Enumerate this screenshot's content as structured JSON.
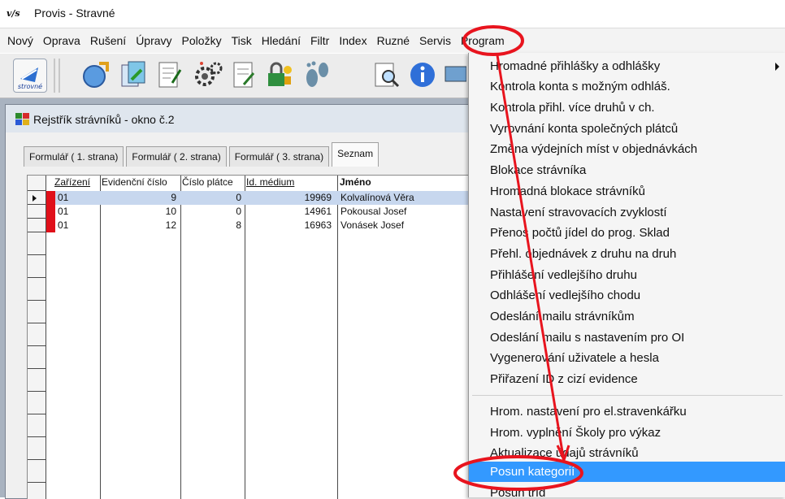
{
  "window": {
    "logo": "v/s",
    "title": "Provis - Stravné"
  },
  "menubar": {
    "items": [
      {
        "label": "Nový",
        "key": "Nový"
      },
      {
        "label": "Oprava"
      },
      {
        "label": "Rušení"
      },
      {
        "label": "Úpravy"
      },
      {
        "label": "Položky"
      },
      {
        "label": "Tisk"
      },
      {
        "label": "Hledání"
      },
      {
        "label": "Filtr"
      },
      {
        "label": "Index"
      },
      {
        "label": "Ruzné"
      },
      {
        "label": "Servis"
      },
      {
        "label": "Program"
      }
    ]
  },
  "toolbar": {
    "stravne_label": "strovné",
    "icons": [
      "stravne-icon",
      "refresh-globe-icon",
      "copy-pages-icon",
      "edit-list-icon",
      "gears-icon",
      "document-edit-icon",
      "lock-key-icon",
      "footprints-icon",
      "search-document-icon",
      "info-icon"
    ]
  },
  "child_window": {
    "title": "Rejstřík strávníků - okno č.2"
  },
  "tabs": [
    {
      "label": "Formulář ( 1. strana)"
    },
    {
      "label": "Formulář ( 2. strana)"
    },
    {
      "label": "Formulář ( 3. strana)"
    },
    {
      "label": "Seznam"
    }
  ],
  "grid": {
    "headers": [
      "Zařízení",
      "Evidenční číslo",
      "Číslo plátce",
      "Id. médium",
      "Jméno"
    ],
    "rows": [
      {
        "zarizeni": "01",
        "evid": "9",
        "platce": "0",
        "medium": "19969",
        "jmeno": "Kolvalínová Věra"
      },
      {
        "zarizeni": "01",
        "evid": "10",
        "platce": "0",
        "medium": "14961",
        "jmeno": "Pokousal Josef"
      },
      {
        "zarizeni": "01",
        "evid": "12",
        "platce": "8",
        "medium": "16963",
        "jmeno": "Vonásek Josef"
      }
    ]
  },
  "dropdown": {
    "items": [
      {
        "label": "Hromadné přihlášky a odhlášky"
      },
      {
        "label": "Kontrola konta s možným odhláš."
      },
      {
        "label": "Kontrola přihl. více druhů v ch."
      },
      {
        "label": "Vyrovnání konta společných plátců"
      },
      {
        "label": "Změna výdejních míst v objednávkách"
      },
      {
        "label": "Blokace strávníka"
      },
      {
        "label": "Hromadná blokace strávníků"
      },
      {
        "label": "Nastavení stravovacích zvyklostí"
      },
      {
        "label": "Přenos počtů jídel do prog. Sklad"
      },
      {
        "label": "Přehl. objednávek z druhu na druh"
      },
      {
        "label": "Přihlášení vedlejšího druhu"
      },
      {
        "label": "Odhlášení vedlejšího chodu"
      },
      {
        "label": "Odeslání mailu strávníkům"
      },
      {
        "label": "Odeslání mailu s nastavením pro OI"
      },
      {
        "label": "Vygenerování uživatele a hesla"
      },
      {
        "label": "Přiřazení ID z cizí evidence"
      },
      {
        "label": "Hrom. nastavení pro el.stravenkářku"
      },
      {
        "label": "Hrom. vyplnění Školy pro výkaz"
      },
      {
        "label": "Aktualizace údajů strávníků"
      },
      {
        "label": "Posun kategorií"
      },
      {
        "label": "Posun tříd"
      }
    ]
  },
  "colors": {
    "highlight": "#3399ff",
    "annotation": "#e8141e",
    "selected_row": "#c7d7ee"
  }
}
